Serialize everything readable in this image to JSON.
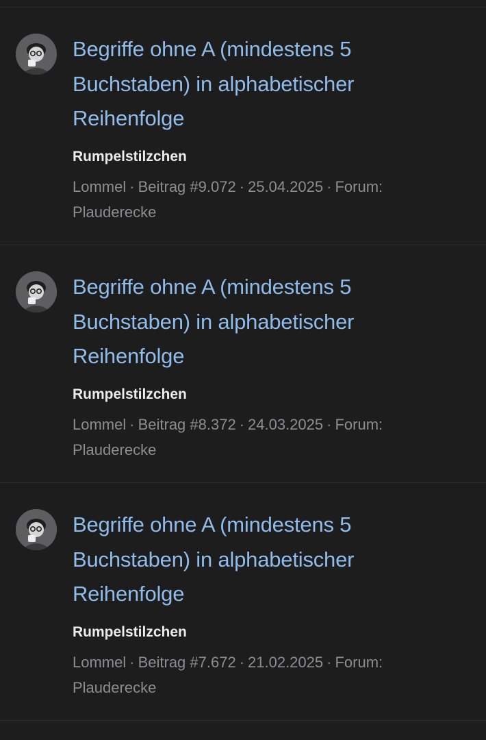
{
  "results": [
    {
      "title": "Begriffe ohne A (mindestens 5 Buchstaben) in alphabetischer Reihenfolge",
      "author": "Rumpelstilzchen",
      "snippet": "Lommel",
      "post": "Beitrag #9.072",
      "date": "25.04.2025",
      "forum_label": "Forum:",
      "forum": "Plauderecke"
    },
    {
      "title": "Begriffe ohne A (mindestens 5 Buchstaben) in alphabetischer Reihenfolge",
      "author": "Rumpelstilzchen",
      "snippet": "Lommel",
      "post": "Beitrag #8.372",
      "date": "24.03.2025",
      "forum_label": "Forum:",
      "forum": "Plauderecke"
    },
    {
      "title": "Begriffe ohne A (mindestens 5 Buchstaben) in alphabetischer Reihenfolge",
      "author": "Rumpelstilzchen",
      "snippet": "Lommel",
      "post": "Beitrag #7.672",
      "date": "21.02.2025",
      "forum_label": "Forum:",
      "forum": "Plauderecke"
    }
  ],
  "separator": "·",
  "colors": {
    "background": "#1d1d1e",
    "title_link": "#8fbcea",
    "author": "#ececec",
    "meta": "#8d8d8f"
  },
  "icons": {
    "avatar": "user-avatar-icon"
  }
}
